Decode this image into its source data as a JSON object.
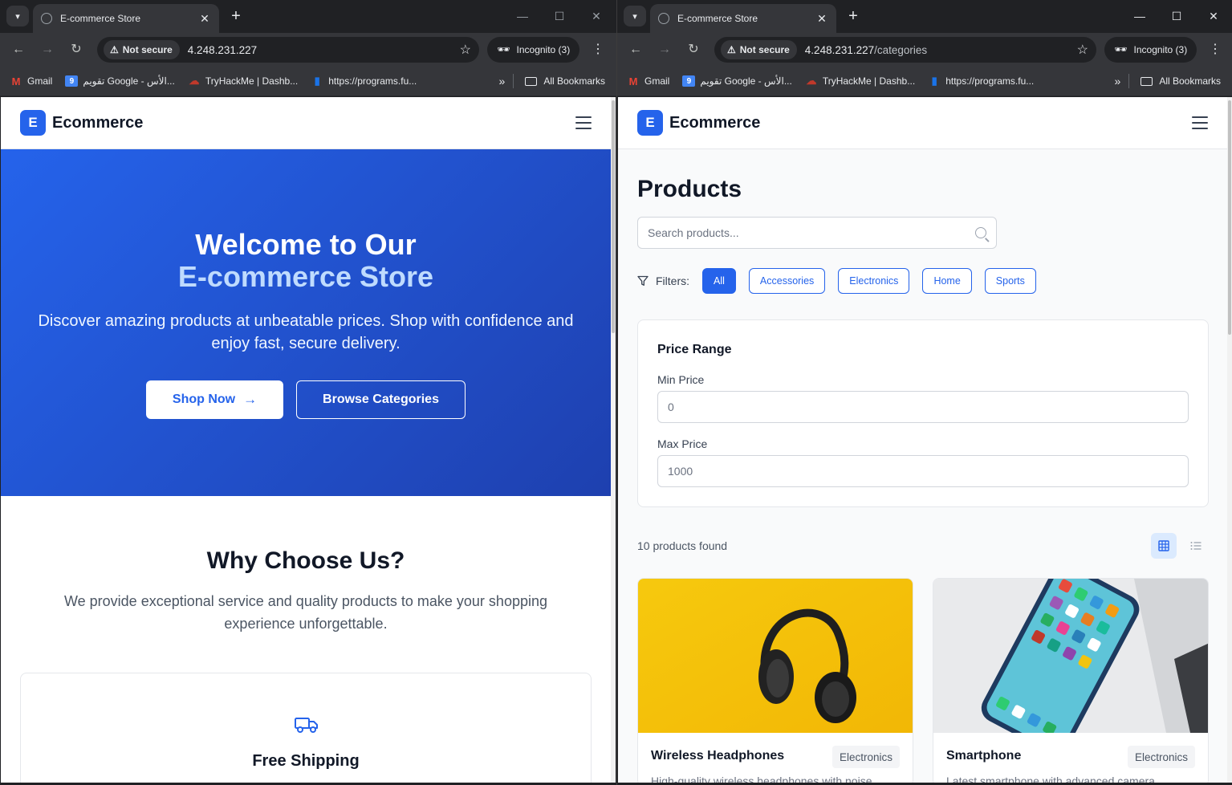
{
  "browser": {
    "tab_title": "E-commerce Store",
    "not_secure": "Not secure",
    "incognito": "Incognito (3)",
    "left": {
      "url_host": "4.248.231.227",
      "url_path": ""
    },
    "right": {
      "url_host": "4.248.231.227",
      "url_path": "/categories"
    },
    "bookmarks": [
      "Gmail",
      "تقويم Google - الأس...",
      "TryHackMe | Dashb...",
      "https://programs.fu..."
    ],
    "all_bookmarks": "All Bookmarks"
  },
  "site": {
    "logo_letter": "E",
    "logo_text": "Ecommerce"
  },
  "home": {
    "hero_title_line1": "Welcome to Our",
    "hero_title_line2": "E-commerce Store",
    "hero_subtitle": "Discover amazing products at unbeatable prices. Shop with confidence and enjoy fast, secure delivery.",
    "shop_now": "Shop Now",
    "browse_categories": "Browse Categories",
    "why_title": "Why Choose Us?",
    "why_subtitle": "We provide exceptional service and quality products to make your shopping experience unforgettable.",
    "feature_title": "Free Shipping"
  },
  "products_page": {
    "title": "Products",
    "search_placeholder": "Search products...",
    "filters_label": "Filters:",
    "filters": [
      "All",
      "Accessories",
      "Electronics",
      "Home",
      "Sports"
    ],
    "active_filter": "All",
    "price_range_title": "Price Range",
    "min_label": "Min Price",
    "min_value": "0",
    "max_label": "Max Price",
    "max_value": "1000",
    "count_text": "10 products found",
    "products": [
      {
        "name": "Wireless Headphones",
        "category": "Electronics",
        "description": "High-quality wireless headphones with noise"
      },
      {
        "name": "Smartphone",
        "category": "Electronics",
        "description": "Latest smartphone with advanced camera"
      }
    ]
  },
  "colors": {
    "primary": "#2563eb",
    "hero_end": "#1e40af",
    "accent_text": "#bfdbfe"
  }
}
